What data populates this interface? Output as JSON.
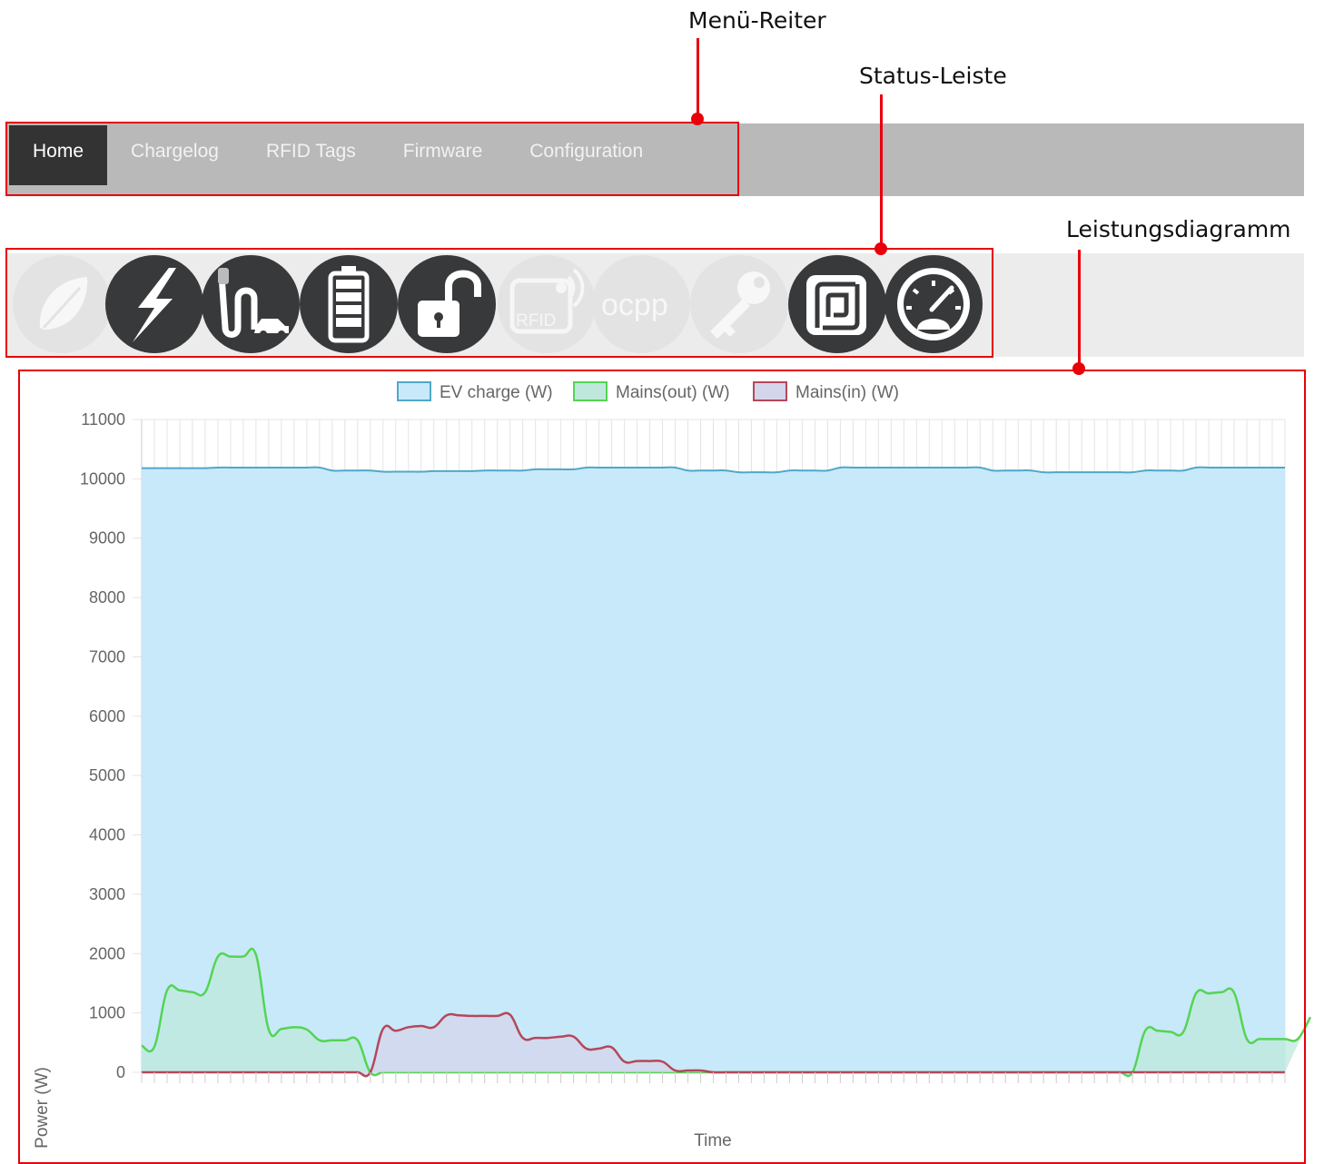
{
  "annotations": {
    "menu": "Menü-Reiter",
    "status": "Status-Leiste",
    "chart": "Leistungsdiagramm"
  },
  "nav": {
    "tabs": [
      {
        "label": "Home",
        "active": true
      },
      {
        "label": "Chargelog",
        "active": false
      },
      {
        "label": "RFID Tags",
        "active": false
      },
      {
        "label": "Firmware",
        "active": false
      },
      {
        "label": "Configuration",
        "active": false
      }
    ]
  },
  "status_bar": {
    "icons": [
      {
        "name": "leaf-icon",
        "active": false
      },
      {
        "name": "lightning-icon",
        "active": true
      },
      {
        "name": "charging-cable-car-icon",
        "active": true
      },
      {
        "name": "battery-icon",
        "active": true
      },
      {
        "name": "unlocked-padlock-icon",
        "active": true
      },
      {
        "name": "rfid-icon",
        "active": false,
        "text": "RFID"
      },
      {
        "name": "ocpp-icon",
        "active": false,
        "text": "ocpp"
      },
      {
        "name": "key-icon",
        "active": false
      },
      {
        "name": "nfc-tag-icon",
        "active": true
      },
      {
        "name": "speedometer-icon",
        "active": true
      }
    ]
  },
  "colors": {
    "ev_fill": "#c8e9f9",
    "ev_line": "#4fa8c8",
    "out_fill": "#bfe8dc",
    "out_line": "#54d454",
    "in_fill": "#d4d4ea",
    "in_line": "#b5475a",
    "annotation": "#e8000b"
  },
  "chart_data": {
    "type": "area",
    "ylabel": "Power (W)",
    "xlabel": "Time",
    "ylim": [
      0,
      11000
    ],
    "yticks": [
      0,
      1000,
      2000,
      3000,
      4000,
      5000,
      6000,
      7000,
      8000,
      9000,
      10000,
      11000
    ],
    "grid": true,
    "legend_position": "top",
    "series": [
      {
        "name": "EV charge (W)",
        "values": [
          10180,
          10180,
          10180,
          10180,
          10180,
          10180,
          10190,
          10190,
          10190,
          10190,
          10190,
          10190,
          10190,
          10190,
          10190,
          10140,
          10140,
          10140,
          10140,
          10120,
          10120,
          10120,
          10120,
          10130,
          10130,
          10130,
          10130,
          10140,
          10140,
          10140,
          10140,
          10160,
          10160,
          10160,
          10160,
          10190,
          10190,
          10190,
          10190,
          10190,
          10190,
          10190,
          10190,
          10140,
          10140,
          10140,
          10140,
          10110,
          10110,
          10110,
          10110,
          10140,
          10140,
          10140,
          10140,
          10190,
          10190,
          10190,
          10190,
          10190,
          10190,
          10190,
          10190,
          10190,
          10190,
          10190,
          10190,
          10140,
          10140,
          10140,
          10140,
          10110,
          10110,
          10110,
          10110,
          10110,
          10110,
          10110,
          10110,
          10140,
          10140,
          10140,
          10140,
          10190,
          10190,
          10190,
          10190,
          10190,
          10190,
          10190,
          10190
        ]
      },
      {
        "name": "Mains(out) (W)",
        "values": [
          450,
          430,
          1380,
          1380,
          1350,
          1350,
          1950,
          1950,
          1950,
          1980,
          720,
          730,
          760,
          720,
          540,
          540,
          540,
          540,
          0,
          0,
          0,
          0,
          0,
          0,
          0,
          0,
          0,
          0,
          0,
          0,
          0,
          0,
          0,
          0,
          0,
          0,
          0,
          0,
          0,
          0,
          0,
          0,
          0,
          0,
          0,
          0,
          0,
          0,
          0,
          0,
          0,
          0,
          0,
          0,
          0,
          0,
          0,
          0,
          0,
          0,
          0,
          0,
          0,
          0,
          0,
          0,
          0,
          0,
          0,
          0,
          0,
          0,
          0,
          0,
          0,
          0,
          0,
          0,
          0,
          700,
          700,
          680,
          680,
          1330,
          1330,
          1350,
          1340,
          560,
          560,
          560,
          560,
          560,
          930
        ]
      },
      {
        "name": "Mains(in) (W)",
        "values": [
          0,
          0,
          0,
          0,
          0,
          0,
          0,
          0,
          0,
          0,
          0,
          0,
          0,
          0,
          0,
          0,
          0,
          0,
          0,
          730,
          700,
          760,
          780,
          760,
          960,
          960,
          950,
          950,
          950,
          970,
          580,
          580,
          580,
          600,
          600,
          400,
          400,
          420,
          180,
          190,
          190,
          180,
          30,
          30,
          30,
          0,
          0,
          0,
          0,
          0,
          0,
          0,
          0,
          0,
          0,
          0,
          0,
          0,
          0,
          0,
          0,
          0,
          0,
          0,
          0,
          0,
          0,
          0,
          0,
          0,
          0,
          0,
          0,
          0,
          0,
          0,
          0,
          0,
          0,
          0,
          0,
          0,
          0,
          0,
          0,
          0,
          0,
          0,
          0,
          0,
          0
        ]
      }
    ]
  }
}
